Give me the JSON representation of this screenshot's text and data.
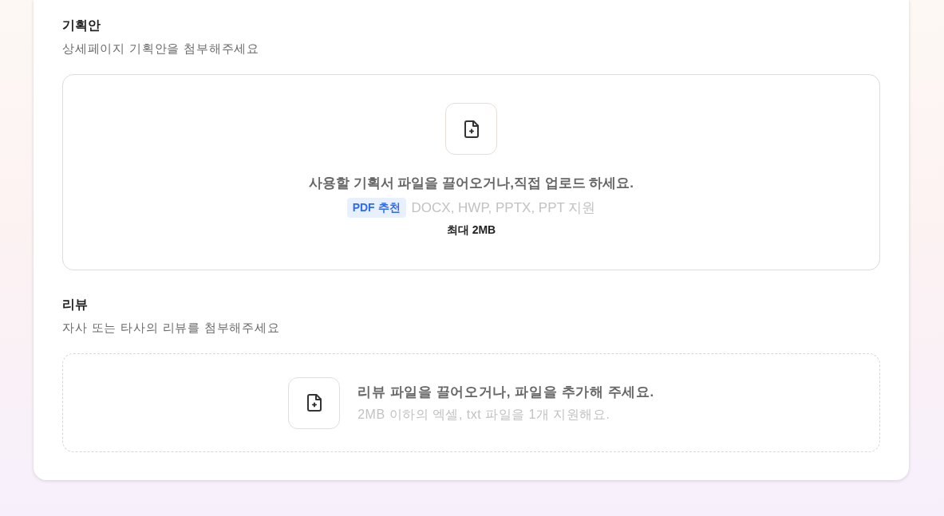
{
  "sections": [
    {
      "title": "기획안",
      "subtitle": "상세페이지 기획안을 첨부해주세요",
      "dropzone": {
        "kind": "stacked",
        "message": "사용할 기획서 파일을 끌어오거나,직접 업로드 하세요.",
        "badge": "PDF 추천",
        "formats": "DOCX, HWP, PPTX, PPT 지원",
        "limit": "최대 2MB"
      }
    },
    {
      "title": "리뷰",
      "subtitle": "자사 또는 타사의 리뷰를 첨부해주세요",
      "dropzone": {
        "kind": "inline",
        "message": "리뷰 파일을 끌어오거나, 파일을 추가해 주세요.",
        "hint": "2MB 이하의 엑셀, txt 파일을 1개 지원해요."
      }
    }
  ]
}
